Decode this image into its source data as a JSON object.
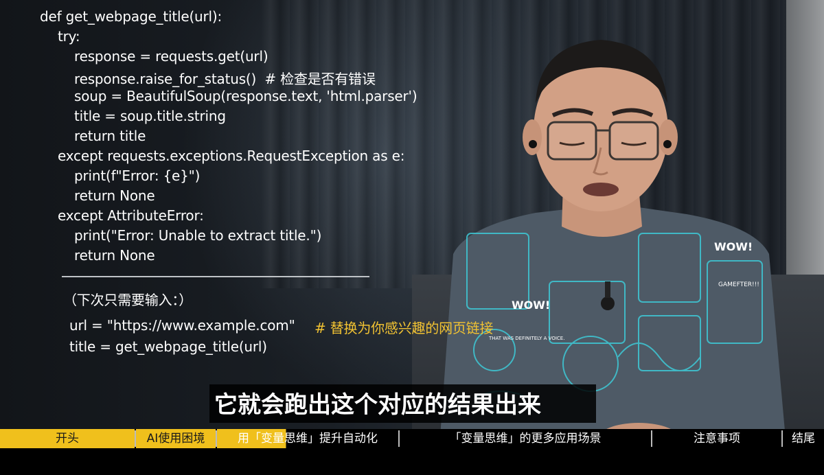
{
  "code_block": {
    "lines": [
      "def get_webpage_title(url):",
      "try:",
      "response = requests.get(url)",
      "response.raise_for_status()  # 检查是否有错误",
      "soup = BeautifulSoup(response.text, 'html.parser')",
      "title = soup.title.string",
      "return title",
      "except requests.exceptions.RequestException as e:",
      "print(f\"Error: {e}\")",
      "return None",
      "except AttributeError:",
      "print(\"Error: Unable to extract title.\")",
      "return None"
    ],
    "note": "（下次只需要输入：）",
    "usage_line1": "url = \"https://www.example.com\"",
    "usage_comment": "# 替换为你感兴趣的网页链接",
    "usage_line2": "title = get_webpage_title(url)"
  },
  "subtitle": "它就会跑出这个对应的结果出来",
  "chapters": [
    {
      "label": "开头",
      "state": "done"
    },
    {
      "label": "AI使用困境",
      "state": "done"
    },
    {
      "label": "用「变量思维」提升自动化",
      "state": "current"
    },
    {
      "label": "「变量思维」的更多应用场景",
      "state": "upcoming"
    },
    {
      "label": "注意事项",
      "state": "upcoming"
    },
    {
      "label": "结尾",
      "state": "upcoming"
    }
  ],
  "colors": {
    "code_text": "#ffffff",
    "comment_highlight": "#f1c232",
    "chapter_active": "#f0c01c",
    "subtitle_bg": "#000000"
  },
  "shirt_text": [
    "WOW!",
    "WOW!",
    "GAMEFTER!!!",
    "THAT WAS DEFINITELY A VOICE."
  ]
}
